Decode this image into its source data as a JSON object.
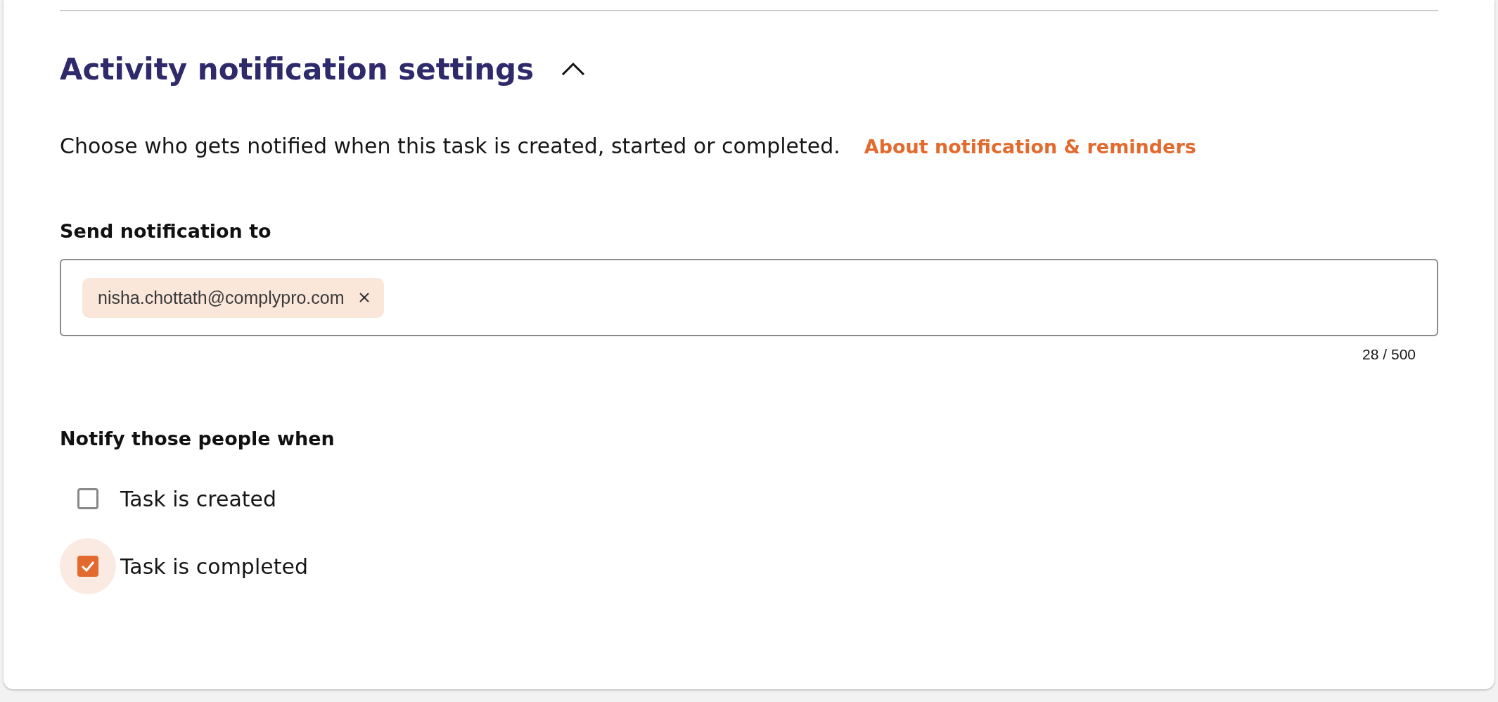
{
  "section": {
    "title": "Activity notification settings",
    "expanded": true,
    "description": "Choose who gets notified when this task is created, started or completed.",
    "help_link": "About notification & reminders"
  },
  "recipients": {
    "label": "Send notification to",
    "chips": [
      {
        "label": "nisha.chottath@complypro.com"
      }
    ],
    "counter": "28 / 500"
  },
  "events": {
    "label": "Notify those people when",
    "options": [
      {
        "label": "Task is created",
        "checked": false,
        "focused": false
      },
      {
        "label": "Task is completed",
        "checked": true,
        "focused": true
      }
    ]
  }
}
